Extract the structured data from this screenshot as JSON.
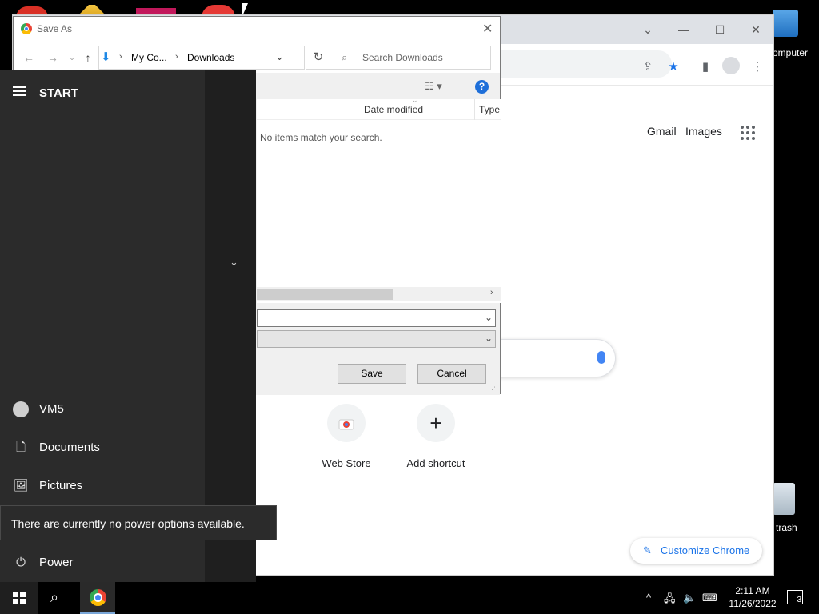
{
  "desktop": {
    "computer_label": "omputer",
    "trash_label": "trash"
  },
  "chrome": {
    "header_links": {
      "gmail": "Gmail",
      "images": "Images"
    },
    "shortcuts": [
      {
        "label": "Web Store"
      },
      {
        "label": "Add shortcut",
        "icon": "+"
      }
    ],
    "customize_label": "Customize Chrome",
    "accent": "#1a73e8"
  },
  "save_as": {
    "title": "Save As",
    "breadcrumb": {
      "root": "My Co...",
      "current": "Downloads"
    },
    "search_placeholder": "Search Downloads",
    "columns": {
      "date_modified": "Date modified",
      "type": "Type"
    },
    "empty_message": "No items match your search.",
    "filename_value": "",
    "save_label": "Save",
    "cancel_label": "Cancel"
  },
  "start_menu": {
    "title": "START",
    "items": [
      {
        "label": "VM5",
        "icon": "user-icon"
      },
      {
        "label": "Documents",
        "icon": "document-icon"
      },
      {
        "label": "Pictures",
        "icon": "pictures-icon"
      },
      {
        "label": "Power",
        "icon": "power-icon"
      }
    ],
    "tooltip": "There are currently no power options available."
  },
  "taskbar": {
    "time": "2:11 AM",
    "date": "11/26/2022",
    "notification_count": "3"
  }
}
